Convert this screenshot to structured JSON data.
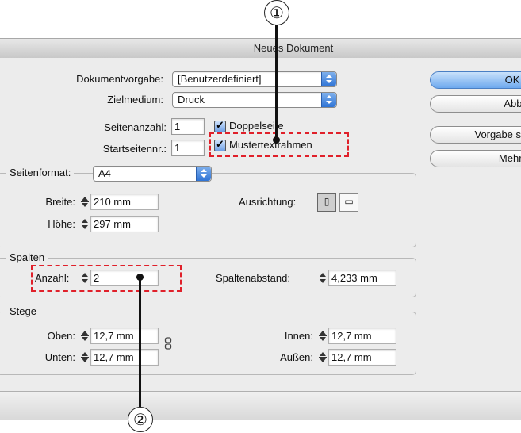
{
  "window": {
    "title": "Neues Dokument"
  },
  "callouts": [
    "①",
    "②"
  ],
  "form": {
    "preset": {
      "label": "Dokumentvorgabe:",
      "value": "[Benutzerdefiniert]"
    },
    "intent": {
      "label": "Zielmedium:",
      "value": "Druck"
    },
    "pages": {
      "label": "Seitenanzahl:",
      "value": "1"
    },
    "start_page": {
      "label": "Startseitennr.:",
      "value": "1"
    },
    "facing_pages": {
      "label": "Doppelseite",
      "checked": true
    },
    "master_text_frame": {
      "label": "Mustertextrahmen",
      "checked": true
    }
  },
  "page_size": {
    "title": "Seitenformat:",
    "value": "A4",
    "width_label": "Breite:",
    "width": "210 mm",
    "height_label": "Höhe:",
    "height": "297 mm",
    "orientation_label": "Ausrichtung:",
    "orientation_icons": [
      "portrait-icon",
      "landscape-icon"
    ]
  },
  "columns": {
    "title": "Spalten",
    "count_label": "Anzahl:",
    "count": "2",
    "gutter_label": "Spaltenabstand:",
    "gutter": "4,233 mm"
  },
  "margins": {
    "title": "Stege",
    "top_label": "Oben:",
    "top": "12,7 mm",
    "bottom_label": "Unten:",
    "bottom": "12,7 mm",
    "inside_label": "Innen:",
    "inside": "12,7 mm",
    "outside_label": "Außen:",
    "outside": "12,7 mm"
  },
  "buttons": {
    "ok": "OK",
    "cancel": "Abbrec",
    "save_preset": "Vorgabe spe",
    "more_options": "Mehr Opt"
  },
  "colors": {
    "highlight": "#e0202a",
    "accent": "#2f74d6"
  }
}
